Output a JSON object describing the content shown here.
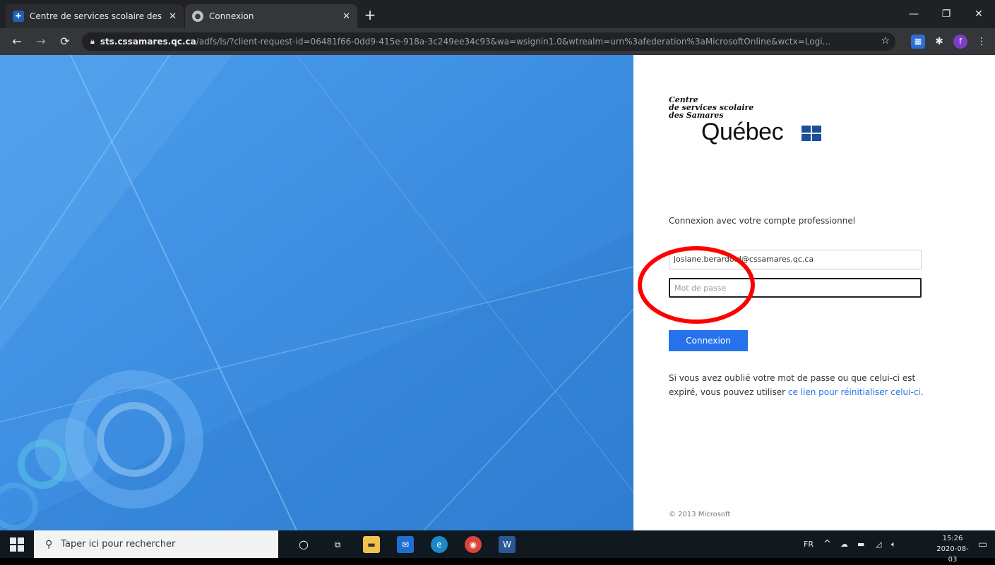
{
  "browser": {
    "tabs": [
      {
        "title": "Centre de services scolaire des S",
        "icon": "school-favicon-icon"
      },
      {
        "title": "Connexion",
        "icon": "globe-icon"
      }
    ],
    "new_tab": "+",
    "url_host": "sts.cssamares.qc.ca",
    "url_path": "/adfs/ls/?client-request-id=06481f66-0dd9-415e-918a-3c249ee34c93&wa=wsignin1.0&wtrealm=urn%3afederation%3aMicrosoftOnline&wctx=Logi...",
    "extension_avatar": "f"
  },
  "page": {
    "logo": {
      "line1": "Centre",
      "line2": "de services scolaire",
      "line3": "des Samares",
      "quebec": "Québec"
    },
    "heading": "Connexion avec votre compte professionnel",
    "email_value": "josiane.berardo.d@cssamares.qc.ca",
    "password_placeholder": "Mot de passe",
    "submit_label": "Connexion",
    "help_text_before": "Si vous avez oublié votre mot de passe ou que celui-ci est expiré, vous pouvez utiliser ",
    "help_link": "ce lien pour réinitialiser celui-ci",
    "help_text_after": ".",
    "footer": "© 2013 Microsoft"
  },
  "taskbar": {
    "search_placeholder": "Taper ici pour rechercher",
    "language": "FR",
    "time": "15:26",
    "date": "2020-08-03"
  },
  "colors": {
    "hero_blue": "#3b8ee0",
    "button_blue": "#2672ec",
    "annotation_red": "#ff0000"
  }
}
